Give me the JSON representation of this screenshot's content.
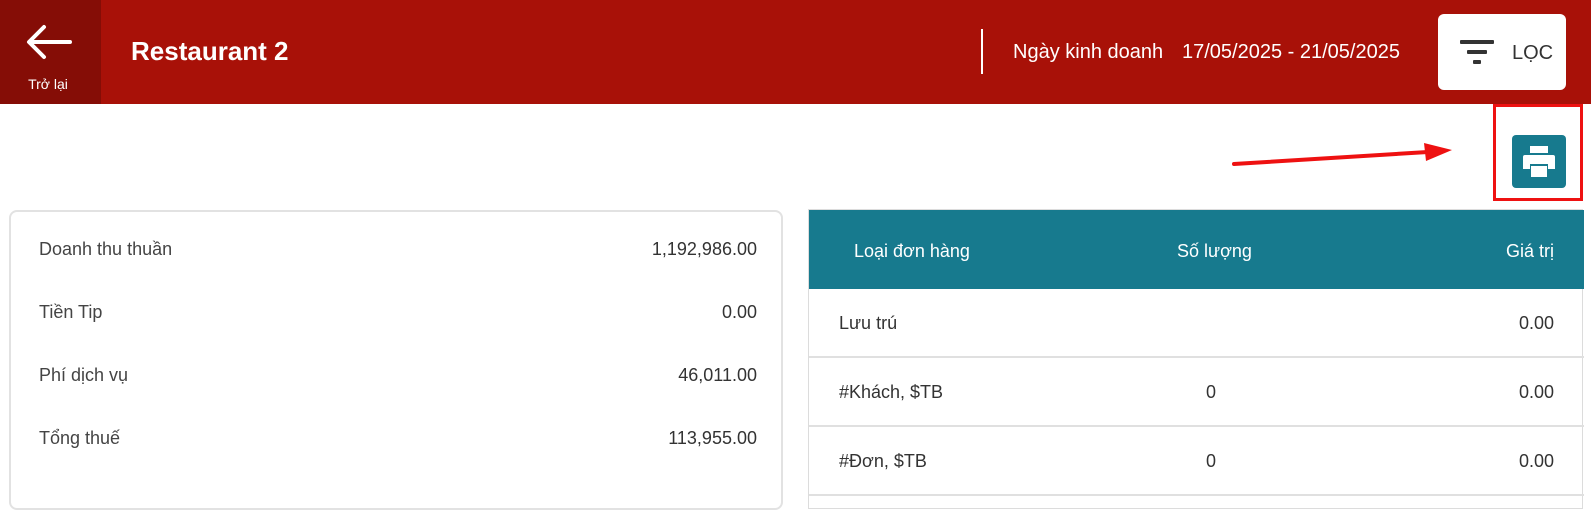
{
  "header": {
    "back_label": "Trở lại",
    "store_name": "Restaurant 2",
    "business_date_label": "Ngày kinh doanh",
    "business_date_range": "17/05/2025 - 21/05/2025",
    "filter_label": "LỌC"
  },
  "colors": {
    "header_bg": "#a81108",
    "back_bg": "#850d06",
    "accent_teal": "#177a8e",
    "highlight_red": "#ee1111"
  },
  "summary": {
    "rows": [
      {
        "label": "Doanh thu thuần",
        "value": "1,192,986.00"
      },
      {
        "label": "Tiền Tip",
        "value": "0.00"
      },
      {
        "label": "Phí dịch vụ",
        "value": "46,011.00"
      },
      {
        "label": "Tổng thuế",
        "value": "113,955.00"
      }
    ]
  },
  "order_table": {
    "headers": [
      "Loại đơn hàng",
      "Số lượng",
      "Giá trị"
    ],
    "rows": [
      {
        "type": "Lưu trú",
        "qty": "",
        "value": "0.00"
      },
      {
        "type": "#Khách, $TB",
        "qty": "0",
        "value": "0.00"
      },
      {
        "type": "#Đơn, $TB",
        "qty": "0",
        "value": "0.00"
      }
    ]
  },
  "icons": {
    "back": "arrow-left-icon",
    "filter": "filter-icon",
    "print": "printer-icon"
  }
}
